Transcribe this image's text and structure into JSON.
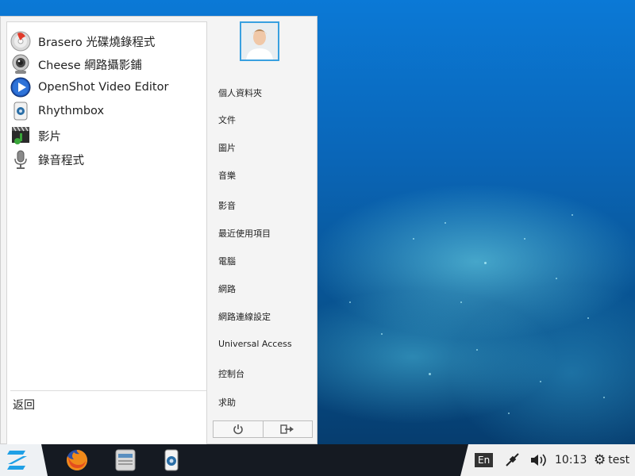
{
  "menu": {
    "apps": [
      {
        "label": "Brasero 光碟燒錄程式",
        "icon": "brasero-icon"
      },
      {
        "label": "Cheese 網路攝影鋪",
        "icon": "webcam-icon"
      },
      {
        "label": "OpenShot Video Editor",
        "icon": "openshot-icon"
      },
      {
        "label": "Rhythmbox",
        "icon": "rhythmbox-icon"
      },
      {
        "label": "影片",
        "icon": "video-icon"
      },
      {
        "label": "錄音程式",
        "icon": "microphone-icon"
      }
    ],
    "back_label": "返回",
    "places": [
      "個人資料夾",
      "文件",
      "圖片",
      "音樂",
      "影音",
      "最近使用項目",
      "電腦",
      "網路",
      "網路連線設定",
      "Universal Access",
      "控制台",
      "求助"
    ],
    "buttons": {
      "power": "power-icon",
      "logout": "logout-icon"
    }
  },
  "taskbar": {
    "apps": [
      "firefox-icon",
      "file-manager-icon",
      "rhythmbox-icon"
    ],
    "tray": {
      "keyboard_layout": "En",
      "time": "10:13",
      "user": "test"
    }
  },
  "colors": {
    "accent": "#39a0e0",
    "taskbar": "#151a22",
    "desktop": "#0a66b8"
  }
}
